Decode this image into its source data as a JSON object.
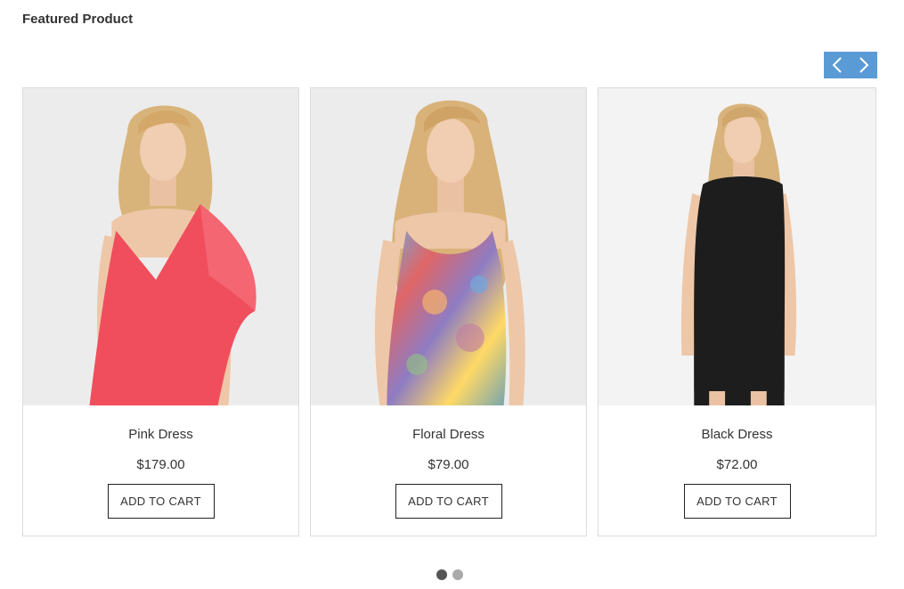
{
  "section": {
    "title": "Featured Product"
  },
  "carousel": {
    "prev_icon": "chevron-left-icon",
    "next_icon": "chevron-right-icon",
    "nav_color": "#5b9bd5",
    "pages": 2,
    "active_page": 1,
    "dot_active_color": "#555555",
    "dot_inactive_color": "#aaaaaa"
  },
  "products": [
    {
      "name": "Pink Dress",
      "price": "$179.00",
      "button_label": "ADD TO CART",
      "image_bg": "#ececec",
      "dress_color": "#f04e5c"
    },
    {
      "name": "Floral Dress",
      "price": "$79.00",
      "button_label": "ADD TO CART",
      "image_bg": "#ececec",
      "dress_color": "#7a8fd1"
    },
    {
      "name": "Black Dress",
      "price": "$72.00",
      "button_label": "ADD TO CART",
      "image_bg": "#f3f3f3",
      "dress_color": "#1d1d1d"
    }
  ]
}
